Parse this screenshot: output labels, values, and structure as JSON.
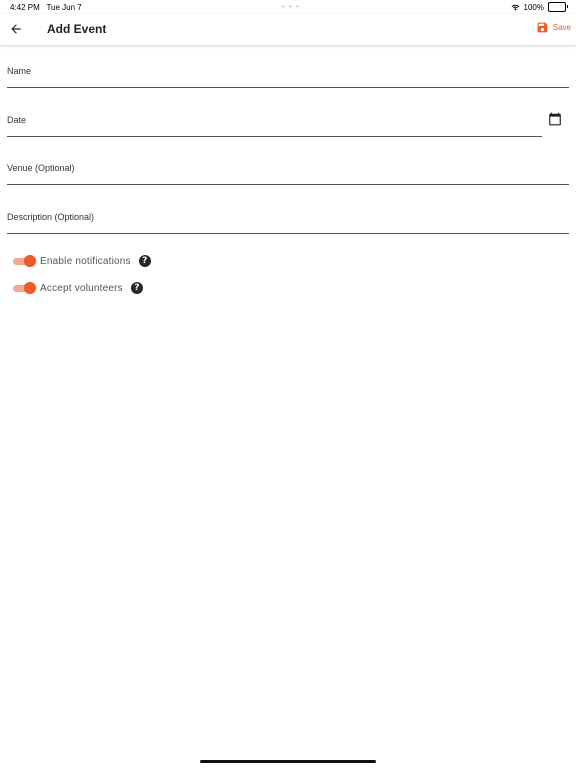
{
  "status_bar": {
    "time": "4:42 PM",
    "date": "Tue Jun 7",
    "dots": "• • •",
    "battery": "100%",
    "wifi_icon": "wifi-icon",
    "battery_icon": "battery-icon"
  },
  "app_bar": {
    "back_icon": "arrow-left-icon",
    "title": "Add Event",
    "save_label": "Save",
    "save_icon": "floppy-disk-icon"
  },
  "form": {
    "name": {
      "label": "Name",
      "value": ""
    },
    "date": {
      "label": "Date",
      "value": "",
      "calendar_icon": "calendar-icon"
    },
    "venue": {
      "label": "Venue (Optional)",
      "value": ""
    },
    "description": {
      "label": "Description (Optional)",
      "value": ""
    }
  },
  "toggles": {
    "notifications": {
      "label": "Enable notifications",
      "enabled": true,
      "help_icon": "help-icon"
    },
    "volunteers": {
      "label": "Accept volunteers",
      "enabled": true,
      "help_icon": "help-icon"
    }
  },
  "colors": {
    "accent": "#f05a28",
    "accent_light": "#f6a98e",
    "help_icon_bg": "#262626"
  }
}
